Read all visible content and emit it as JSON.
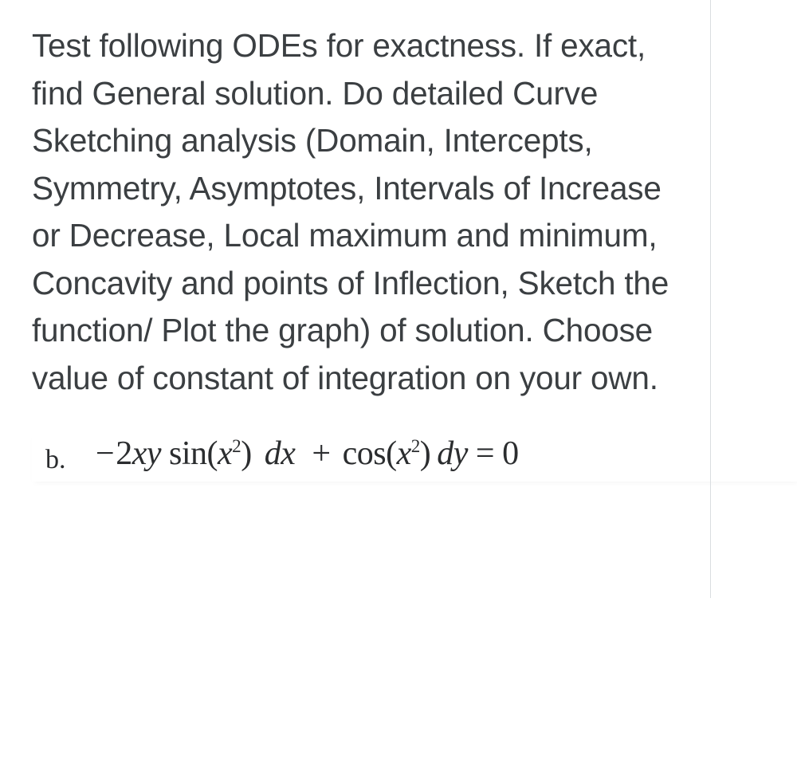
{
  "problem": {
    "instructions": "Test following ODEs for exactness. If exact, find General solution. Do detailed Curve Sketching analysis (Domain, Intercepts, Symmetry, Asymptotes, Intervals of Increase or Decrease, Local maximum and minimum, Concavity and points of Inflection, Sketch the function/ Plot the graph) of solution. Choose value of constant of integration on your own."
  },
  "item": {
    "label": "b.",
    "equation_plain": "-2xy sin(x^2) dx + cos(x^2) dy = 0",
    "parts": {
      "minus": "−",
      "coef": "2",
      "x": "x",
      "y": "y",
      "sin": "sin",
      "cos": "cos",
      "lpar": "(",
      "rpar": ")",
      "sq": "2",
      "var_x": "x",
      "d": "d",
      "plus": "+",
      "eq": "=",
      "zero": "0"
    }
  }
}
